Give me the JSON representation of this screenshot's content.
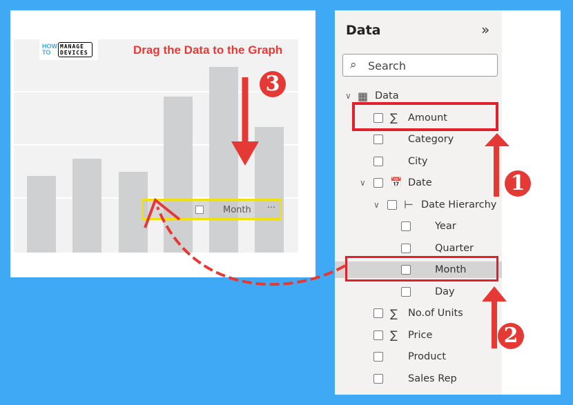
{
  "slide_title": "Drag the Data to the Graph",
  "logo": {
    "part1": "HOW TO",
    "part2": "MANAGE DEVICES"
  },
  "chart": {
    "dragged_field": "Month",
    "more": "···",
    "bar_levels": [
      0.36,
      0.44,
      0.38,
      0.73,
      0.87,
      0.59
    ]
  },
  "panel": {
    "title": "Data",
    "collapse_icon": "»",
    "search_placeholder": "Search",
    "items": [
      {
        "label": "Data",
        "icon": "table-icon",
        "level": 0,
        "expand": true
      },
      {
        "label": "Amount",
        "icon": "sigma-icon",
        "level": 1
      },
      {
        "label": "Category",
        "level": 1
      },
      {
        "label": "City",
        "level": 1
      },
      {
        "label": "Date",
        "icon": "calendar-icon",
        "level": 1,
        "expand": true
      },
      {
        "label": "Date Hierarchy",
        "icon": "hierarchy-icon",
        "level": 2,
        "expand": true
      },
      {
        "label": "Year",
        "level": 3
      },
      {
        "label": "Quarter",
        "level": 3
      },
      {
        "label": "Month",
        "level": 3,
        "highlight": true
      },
      {
        "label": "Day",
        "level": 3
      },
      {
        "label": "No.of Units",
        "icon": "sigma-icon",
        "level": 1
      },
      {
        "label": "Price",
        "icon": "sigma-icon",
        "level": 1
      },
      {
        "label": "Product",
        "level": 1
      },
      {
        "label": "Sales Rep",
        "level": 1
      }
    ]
  },
  "steps": [
    "1",
    "2",
    "3"
  ],
  "colors": {
    "background": "#3fa9f5",
    "annotation": "#e53935",
    "highlight": "#f0e10c"
  }
}
